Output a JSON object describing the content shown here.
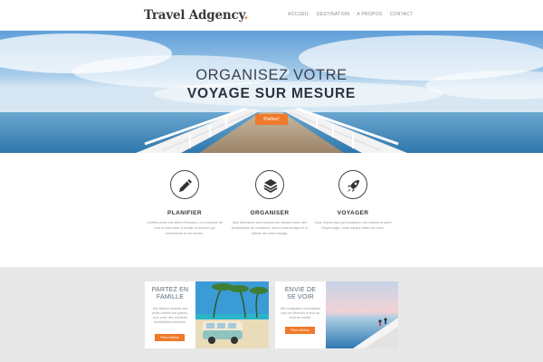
{
  "brand": {
    "name": "Travel Adgency",
    "dot": ".",
    "accent": "#f0792a"
  },
  "nav": [
    "Accueil",
    "Destination",
    "A propos",
    "Contact"
  ],
  "hero": {
    "title_line1": "ORGANISEZ VOTRE",
    "title_line2": "VOYAGE SUR MESURE",
    "button": "Partez!"
  },
  "features": [
    {
      "icon": "pen-icon",
      "title": "PLANIFIER",
      "text": "Confiez-nous vos idées d'évasion, on s'occupe de tout et vous aide à choisir la formule qui correspond à vos envies."
    },
    {
      "icon": "layers-icon",
      "title": "ORGANISER",
      "text": "Nos itinéraires sont conçus sur mesure avec des prestataires de confiance, selon votre budget et le rythme de votre voyage."
    },
    {
      "icon": "rocket-icon",
      "title": "VOYAGER",
      "text": "Vous n'avez plus qu'à préparer vos valises et partir l'esprit léger, notre équipe veille sur vous."
    }
  ],
  "cards": [
    {
      "title": "PARTEZ EN FAMILLE",
      "text": "Des séjours adaptés aux petits comme aux grands, pour créer des souvenirs inoubliables ensemble.",
      "button": "Plus d'infos"
    },
    {
      "title": "ENVIE DE SE VOIR",
      "text": "Des escapades romantiques pour se retrouver à deux au bout du monde.",
      "button": "Plus d'infos"
    }
  ]
}
